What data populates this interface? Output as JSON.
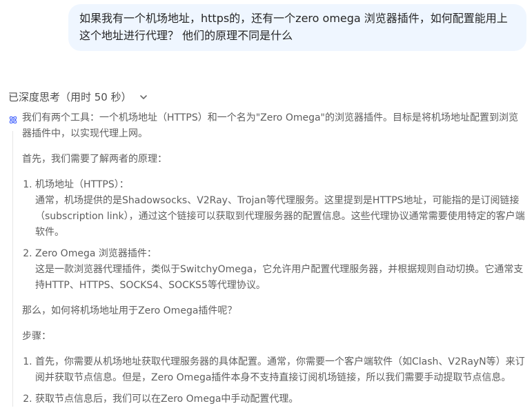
{
  "user_message": "如果我有一个机场地址，https的，还有一个zero omega 浏览器插件，如何配置能用上这个地址进行代理？ 他们的原理不同是什么",
  "thinking": {
    "header": "已深度思考（用时 50 秒）",
    "intro": "我们有两个工具：一个机场地址（HTTPS）和一个名为\"Zero Omega\"的浏览器插件。目标是将机场地址配置到浏览器插件中，以实现代理上网。",
    "principle_lead": "首先，我们需要了解两者的原理：",
    "principles": [
      {
        "title": "机场地址（HTTPS）：",
        "detail": "通常，机场提供的是Shadowsocks、V2Ray、Trojan等代理服务。这里提到是HTTPS地址，可能指的是订阅链接（subscription link），通过这个链接可以获取到代理服务器的配置信息。这些代理协议通常需要使用特定的客户端软件。"
      },
      {
        "title": "Zero Omega 浏览器插件：",
        "detail": "这是一款浏览器代理插件，类似于SwitchyOmega，它允许用户配置代理服务器，并根据规则自动切换。它通常支持HTTP、HTTPS、SOCKS4、SOCKS5等代理协议。"
      }
    ],
    "question": "那么，如何将机场地址用于Zero Omega插件呢？",
    "steps_label": "步骤：",
    "steps": [
      "首先，你需要从机场地址获取代理服务器的具体配置。通常，你需要一个客户端软件（如Clash、V2RayN等）来订阅并获取节点信息。但是，Zero Omega插件本身不支持直接订阅机场链接，所以我们需要手动提取节点信息。",
      "获取节点信息后，我们可以在Zero Omega中手动配置代理。"
    ]
  }
}
